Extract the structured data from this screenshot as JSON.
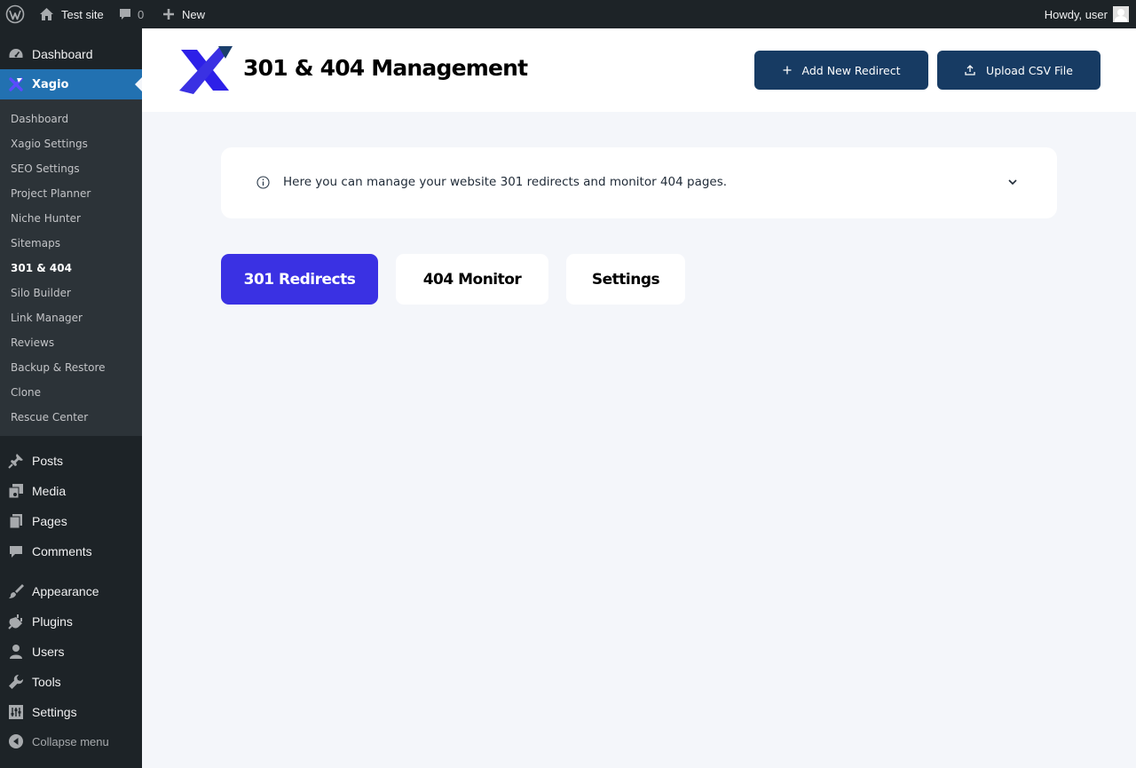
{
  "admin_bar": {
    "site_name": "Test site",
    "comments_count": "0",
    "new_label": "New",
    "howdy": "Howdy, user"
  },
  "sidebar": {
    "top_items": [
      {
        "label": "Dashboard",
        "icon": "dashboard-icon"
      },
      {
        "label": "Xagio",
        "icon": "xagio-logo-icon"
      }
    ],
    "submenu": [
      "Dashboard",
      "Xagio Settings",
      "SEO Settings",
      "Project Planner",
      "Niche Hunter",
      "Sitemaps",
      "301 & 404",
      "Silo Builder",
      "Link Manager",
      "Reviews",
      "Backup & Restore",
      "Clone",
      "Rescue Center"
    ],
    "active_submenu": "301 & 404",
    "items": [
      {
        "label": "Posts",
        "icon": "pin-icon"
      },
      {
        "label": "Media",
        "icon": "media-icon"
      },
      {
        "label": "Pages",
        "icon": "pages-icon"
      },
      {
        "label": "Comments",
        "icon": "comment-icon"
      },
      {
        "label": "Appearance",
        "icon": "brush-icon"
      },
      {
        "label": "Plugins",
        "icon": "plugin-icon"
      },
      {
        "label": "Users",
        "icon": "user-icon"
      },
      {
        "label": "Tools",
        "icon": "wrench-icon"
      },
      {
        "label": "Settings",
        "icon": "settings-sliders-icon"
      }
    ],
    "collapse_label": "Collapse menu"
  },
  "header": {
    "title": "301 & 404 Management",
    "add_button": "Add New Redirect",
    "upload_button": "Upload CSV File"
  },
  "info": {
    "text": "Here you can manage your website 301 redirects and monitor 404 pages."
  },
  "tabs": [
    {
      "label": "301 Redirects",
      "active": true
    },
    {
      "label": "404 Monitor",
      "active": false
    },
    {
      "label": "Settings",
      "active": false
    }
  ],
  "colors": {
    "admin_dark": "#1d2327",
    "admin_blue": "#2271b1",
    "header_button": "#173b63",
    "active_tab": "#3a31e3",
    "background": "#f4f6fa"
  }
}
